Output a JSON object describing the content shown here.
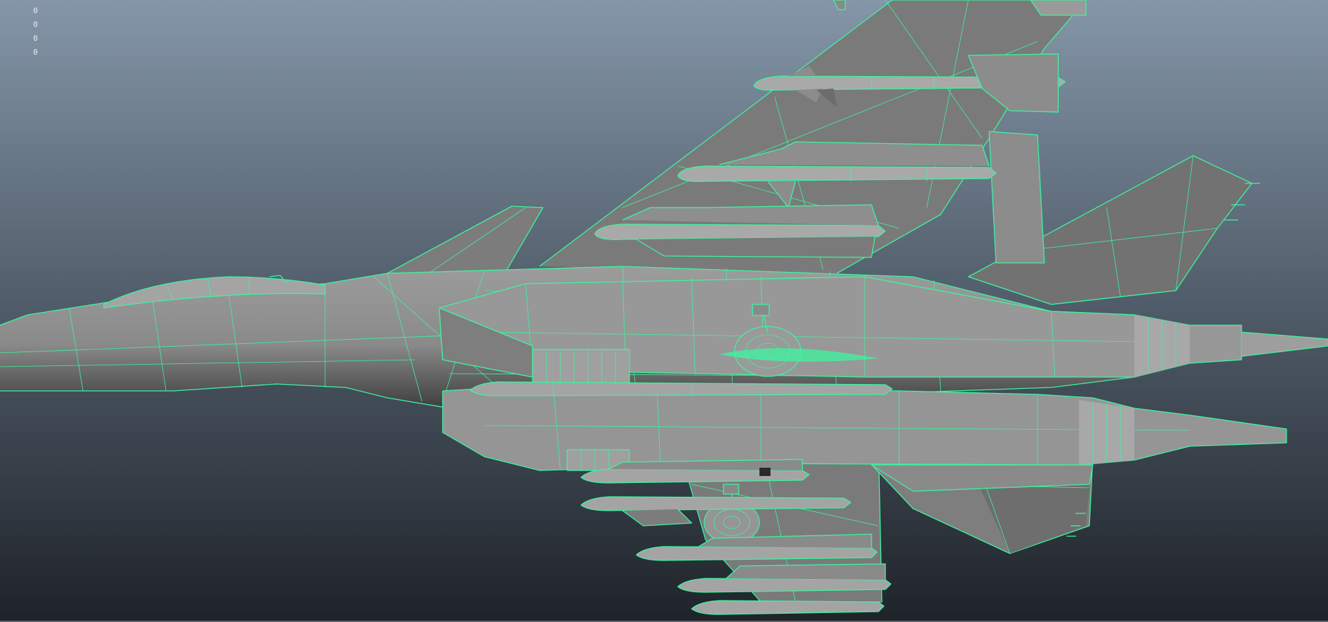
{
  "viewport": {
    "hud_values": [
      "0",
      "0",
      "0",
      "0"
    ]
  },
  "colors": {
    "background_top": "#8496a8",
    "background_bottom": "#1f2329",
    "wireframe": "#3cf5a0",
    "mesh_fill": "#8e8e8e",
    "mesh_fill_dark": "#6b6b6b",
    "mesh_fill_light": "#a5a5a5"
  },
  "icons": {
    "model": "aircraft-wireframe-model",
    "missile": "missile-model"
  }
}
